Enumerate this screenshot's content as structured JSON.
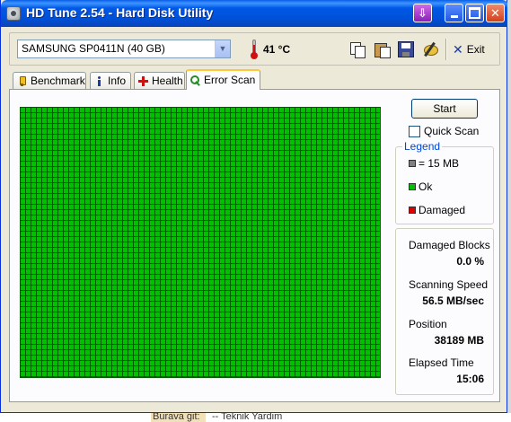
{
  "window": {
    "title": "HD Tune 2.54 - Hard Disk Utility",
    "caption_buttons": [
      "download-icon",
      "minimize-icon",
      "maximize-icon",
      "close-icon"
    ]
  },
  "toolbar": {
    "drive_selected": "SAMSUNG SP0411N (40 GB)",
    "temperature": "41 °C",
    "icons": [
      "copy-icon",
      "paste-icon",
      "save-icon",
      "options-icon"
    ],
    "exit_label": "Exit"
  },
  "tabs": [
    {
      "label": "Benchmark",
      "icon": "benchmark-icon"
    },
    {
      "label": "Info",
      "icon": "info-icon"
    },
    {
      "label": "Health",
      "icon": "health-icon"
    },
    {
      "label": "Error Scan",
      "icon": "error-scan-icon",
      "active": true
    }
  ],
  "error_scan": {
    "start_label": "Start",
    "quick_scan_label": "Quick Scan",
    "quick_scan_checked": false,
    "legend": {
      "title": "Legend",
      "items": [
        {
          "label": "= 15 MB",
          "color": "#808080"
        },
        {
          "label": "Ok",
          "color": "#00c000"
        },
        {
          "label": "Damaged",
          "color": "#e00000"
        }
      ]
    },
    "block_color": "#00c000",
    "stats": {
      "damaged_blocks_label": "Damaged Blocks",
      "damaged_blocks_value": "0.0 %",
      "scanning_speed_label": "Scanning Speed",
      "scanning_speed_value": "56.5 MB/sec",
      "position_label": "Position",
      "position_value": "38189 MB",
      "elapsed_time_label": "Elapsed Time",
      "elapsed_time_value": "15:06"
    }
  },
  "background_window": {
    "label": "Burava git:",
    "text": "-- Teknik Yardim"
  }
}
